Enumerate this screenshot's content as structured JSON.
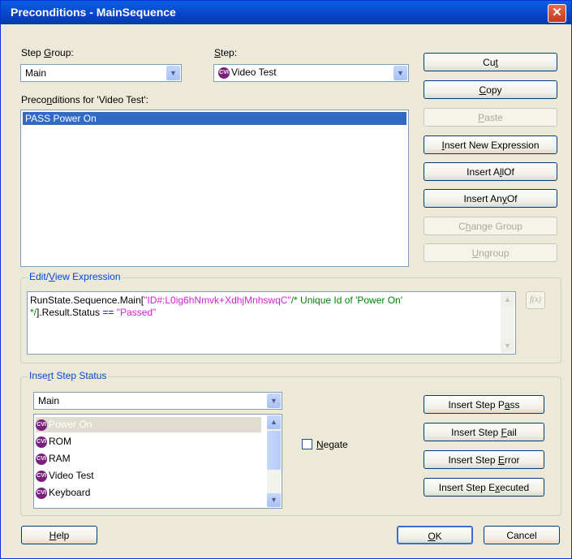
{
  "window": {
    "title": "Preconditions - MainSequence",
    "close_glyph": "✕"
  },
  "step_group": {
    "label_pre": "Step ",
    "label_key": "G",
    "label_post": "roup:",
    "value": "Main"
  },
  "step": {
    "label_key": "S",
    "label_post": "tep:",
    "value": "Video Test"
  },
  "preconditions": {
    "label_pre": "Preco",
    "label_key": "n",
    "label_post": "ditions for 'Video Test':",
    "items": [
      "PASS Power On"
    ]
  },
  "buttons": {
    "cut": {
      "pre": "Cu",
      "key": "t",
      "post": ""
    },
    "copy": {
      "pre": "",
      "key": "C",
      "post": "opy"
    },
    "paste": {
      "pre": "",
      "key": "P",
      "post": "aste"
    },
    "insert_new_expression": {
      "pre": "",
      "key": "I",
      "post": "nsert New Expression"
    },
    "insert_allof": {
      "pre": "Insert A",
      "key": "l",
      "post": "lOf"
    },
    "insert_anyof": {
      "pre": "Insert An",
      "key": "y",
      "post": "Of"
    },
    "change_group": {
      "pre": "C",
      "key": "h",
      "post": "ange Group"
    },
    "ungroup": {
      "pre": "",
      "key": "U",
      "post": "ngroup"
    },
    "help": {
      "pre": "",
      "key": "H",
      "post": "elp"
    },
    "ok": {
      "pre": "",
      "key": "O",
      "post": "K"
    },
    "cancel": {
      "label": "Cancel"
    }
  },
  "edit_view": {
    "label_pre": "Edit/",
    "label_key": "V",
    "label_post": "iew Expression",
    "expr": {
      "p1": "RunState.Sequence.Main[",
      "p2": "\"ID#:L0ig6hNmvk+XdhjMnhswqC\"",
      "p3": "/* Unique Id of 'Power On'",
      "p4": "*/",
      "p5": "].Result.Status ",
      "p6": "==",
      "p7": " ",
      "p8": "\"Passed\""
    },
    "fx_label": "f(x)"
  },
  "insert_step_status": {
    "label_pre": "Inse",
    "label_key": "r",
    "label_post": "t Step Status",
    "group_value": "Main",
    "steps": [
      "Power On",
      "ROM",
      "RAM",
      "Video Test",
      "Keyboard"
    ],
    "selected_step": "Power On",
    "negate": {
      "label_key": "N",
      "label_post": "egate",
      "checked": false
    },
    "buttons": {
      "pass": {
        "pre": "Insert Step P",
        "key": "a",
        "post": "ss"
      },
      "fail": {
        "pre": "Insert Step ",
        "key": "F",
        "post": "ail"
      },
      "error": {
        "pre": "Insert Step ",
        "key": "E",
        "post": "rror"
      },
      "executed": {
        "pre": "Insert Step E",
        "key": "x",
        "post": "ecuted"
      }
    }
  },
  "step_icon_text": "CVI",
  "colors": {
    "title_bar": "#0a5fe0",
    "selection": "#316ac5",
    "group_label": "#0046d5",
    "string_literal": "#d321d3",
    "comment": "#008000",
    "operator": "#0000ff"
  }
}
